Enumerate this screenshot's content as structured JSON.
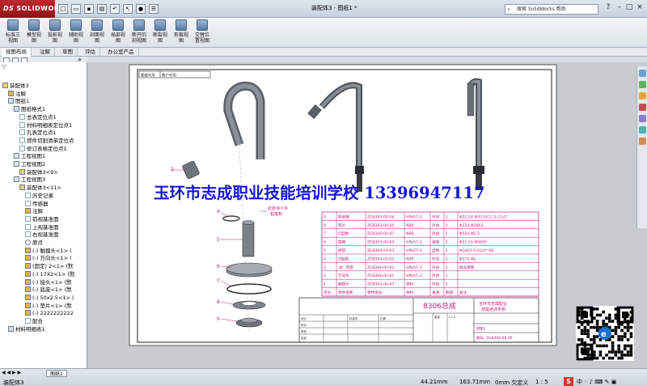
{
  "app": {
    "brand": "SOLIDWORKS",
    "brand_prefix": "DS",
    "document_title": "装配体3 - 图纸1 *",
    "search_placeholder": "搜索 SolidWorks 帮助"
  },
  "ribbon": {
    "buttons": [
      {
        "label": "标准三\n视图"
      },
      {
        "label": "模型视\n图"
      },
      {
        "label": "投影视\n图"
      },
      {
        "label": "辅助视\n图"
      },
      {
        "label": "剖面视\n图"
      },
      {
        "label": "局部视\n图"
      },
      {
        "label": "断开的\n剖视图"
      },
      {
        "label": "断裂视\n图"
      },
      {
        "label": "剪裁视\n图"
      },
      {
        "label": "交替位\n置视图"
      }
    ]
  },
  "tabs": [
    {
      "label": "视图布局",
      "active": true
    },
    {
      "label": "注解",
      "active": false
    },
    {
      "label": "草图",
      "active": false
    },
    {
      "label": "评估",
      "active": false
    },
    {
      "label": "办公室产品",
      "active": false
    }
  ],
  "tree": {
    "items": [
      {
        "label": "装配体3",
        "icon": "asm",
        "indent": 0
      },
      {
        "label": "注解",
        "icon": "part",
        "indent": 1
      },
      {
        "label": "图纸1",
        "icon": "sheet",
        "indent": 1
      },
      {
        "label": "图纸格式1",
        "icon": "sheet",
        "indent": 2
      },
      {
        "label": "总表定位点1",
        "icon": "plane",
        "indent": 3
      },
      {
        "label": "材料明细表定位点1",
        "icon": "plane",
        "indent": 3
      },
      {
        "label": "孔表定位点1",
        "icon": "plane",
        "indent": 3
      },
      {
        "label": "焊件切割清单定位点",
        "icon": "plane",
        "indent": 3
      },
      {
        "label": "修订表格定位点1",
        "icon": "plane",
        "indent": 3
      },
      {
        "label": "工程视图1",
        "icon": "view",
        "indent": 2
      },
      {
        "label": "工程视图2",
        "icon": "view",
        "indent": 2
      },
      {
        "label": "装配体3<9>",
        "icon": "asm",
        "indent": 3
      },
      {
        "label": "工程视图3",
        "icon": "view",
        "indent": 2
      },
      {
        "label": "装配体3<11>",
        "icon": "asm",
        "indent": 3
      },
      {
        "label": "历史记录",
        "icon": "plane",
        "indent": 4
      },
      {
        "label": "传感器",
        "icon": "plane",
        "indent": 4
      },
      {
        "label": "注解",
        "icon": "part",
        "indent": 4
      },
      {
        "label": "前视基准面",
        "icon": "plane",
        "indent": 4
      },
      {
        "label": "上视基准面",
        "icon": "plane",
        "indent": 4
      },
      {
        "label": "右视基准面",
        "icon": "plane",
        "indent": 4
      },
      {
        "label": "原点",
        "icon": "origin",
        "indent": 4
      },
      {
        "label": "(-) 触摸头<1> (",
        "icon": "part",
        "indent": 4
      },
      {
        "label": "(-) 万向头<1> (",
        "icon": "part",
        "indent": 4
      },
      {
        "label": "(固定) 2<1> (默",
        "icon": "part",
        "indent": 4
      },
      {
        "label": "(-) 17X2<1> (默",
        "icon": "part",
        "indent": 4
      },
      {
        "label": "(-) 接头<1> (默",
        "icon": "part",
        "indent": 4
      },
      {
        "label": "(-) 底座<1> (默",
        "icon": "part",
        "indent": 4
      },
      {
        "label": "(-) 50x2.5<1> (",
        "icon": "part",
        "indent": 4
      },
      {
        "label": "(-) 垫片<1> (默",
        "icon": "part",
        "indent": 4
      },
      {
        "label": "(-) 2222222222",
        "icon": "part",
        "indent": 4
      },
      {
        "label": "配合",
        "icon": "plane",
        "indent": 4
      },
      {
        "label": "材料明细表1",
        "icon": "sheet",
        "indent": 1
      }
    ]
  },
  "drawing": {
    "corner_text_1": "图纸代号",
    "corner_text_2": "客户代号:",
    "watermark": "玉环市志成职业技能培训学校 13396947117",
    "annotation": "此处涂少许\n铅笔粉",
    "balloons": [
      "2",
      "4",
      "5",
      "6",
      "7",
      "8",
      "9"
    ],
    "bom": {
      "headers": [
        "序号",
        "零件名称",
        "零件图号",
        "材料",
        "来源",
        "数量",
        "备注"
      ],
      "rows": [
        [
          "9",
          "防滚帽",
          "ZG8303-00-06",
          "HPb57-3",
          "外协",
          "1",
          "Φ22.5X Φ35.5X11.5-G1/2\""
        ],
        [
          "8",
          "垫片",
          "ZG8303-00-05",
          "NBR",
          "外协",
          "1",
          "Φ22X Φ38X3"
        ],
        [
          "7",
          "O型圈",
          "ZG8105-00-07",
          "NBR",
          "外协",
          "1",
          "Φ50X Φ2.5"
        ],
        [
          "6",
          "底座",
          "ZG8303-00-04",
          "HPb57-3",
          "自制",
          "1",
          "Φ21.5X Φ58X6"
        ],
        [
          "5",
          "接管",
          "ZG8303-00-03",
          "HPb57-3",
          "自制",
          "1",
          "M18X1.5-G1/2\"-80"
        ],
        [
          "4",
          "O型圈",
          "ZG8303-00-02",
          "NBR",
          "外协",
          "1",
          "Φ17X Φ2"
        ],
        [
          "3",
          "38° 弯管",
          "ZG8306-00-02",
          "HPb57-3",
          "外协",
          "1",
          "抛光镀铬"
        ],
        [
          "2",
          "万向头",
          "ZG8306-00-01",
          "HPb57-3",
          "外协",
          "1",
          ""
        ],
        [
          "1",
          "触摸头",
          "ZG8302-00-07",
          "塑料",
          "外协",
          "1",
          ""
        ]
      ]
    },
    "title_block": {
      "product": "8306总成",
      "school": "玉环市志成职业\n技能培训学校",
      "material_label": "材料:",
      "drawing_no": "图号: ZG8306-00-00",
      "scale_text": "1:1.5",
      "weight_text": "重量",
      "labels": [
        "设计",
        "校对",
        "审核",
        "批准",
        "标准化",
        "日期"
      ]
    }
  },
  "status": {
    "left_text": "装配体3",
    "sheet_tab": "图纸1",
    "x_value": "44.21mm",
    "y_value": "163.71mm",
    "z_value": "0mm 欠定义",
    "scale": "1 : 5"
  },
  "colors": {
    "brand_red": "#b3202a",
    "magenta": "#c8167a",
    "watermark_blue": "#1515d8",
    "part_gray": "#7a7f88"
  }
}
